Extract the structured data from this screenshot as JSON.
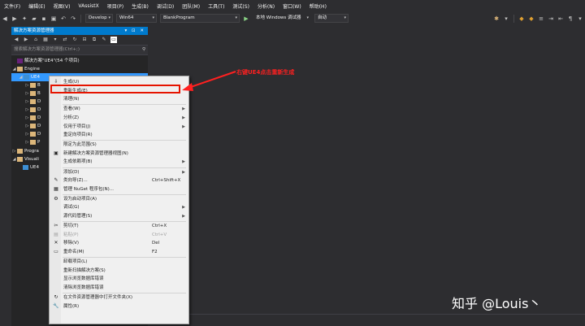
{
  "menubar": [
    "文件(F)",
    "编辑(E)",
    "视图(V)",
    "VAssistX",
    "项目(P)",
    "生成(B)",
    "调试(D)",
    "团队(M)",
    "工具(T)",
    "测试(S)",
    "分析(N)",
    "窗口(W)",
    "帮助(H)"
  ],
  "toolbar": {
    "config": "Develop",
    "platform": "Win64",
    "startup": "BlankProgram",
    "debugger": "本地 Windows 调试器",
    "debug_mode": "自动"
  },
  "solution_explorer": {
    "title": "解决方案资源管理器",
    "title_controls": "▾ ⊡ ✕",
    "search_placeholder": "搜索解决方案资源管理器(Ctrl+;)",
    "solution_label": "解决方案\"UE4\"(54 个项目)",
    "engine_label": "Engine",
    "ue4_label": "UE4",
    "folder_letters": [
      "B",
      "B",
      "D",
      "D",
      "D",
      "D",
      "D",
      "P"
    ],
    "programs_label": "Progra",
    "visualizers_label": "Visuali",
    "ue4_file_label": "UE4"
  },
  "context_menu": {
    "items": [
      {
        "label": "生成(U)",
        "shortcut": "",
        "glyph": "⇩",
        "sub": false,
        "disabled": false
      },
      {
        "label": "重新生成(E)",
        "shortcut": "",
        "glyph": "",
        "sub": false,
        "disabled": false
      },
      {
        "label": "清理(N)",
        "shortcut": "",
        "glyph": "",
        "sub": false,
        "disabled": false
      },
      {
        "label": "查看(W)",
        "shortcut": "",
        "glyph": "",
        "sub": true,
        "disabled": false
      },
      {
        "label": "分析(Z)",
        "shortcut": "",
        "glyph": "",
        "sub": true,
        "disabled": false
      },
      {
        "label": "仅用于项目(J)",
        "shortcut": "",
        "glyph": "",
        "sub": true,
        "disabled": false
      },
      {
        "label": "重定向项目(R)",
        "shortcut": "",
        "glyph": "",
        "sub": false,
        "disabled": false
      },
      {
        "label": "限定为此范围(S)",
        "shortcut": "",
        "glyph": "",
        "sub": false,
        "disabled": false
      },
      {
        "label": "新建解决方案资源管理器视图(N)",
        "shortcut": "",
        "glyph": "▣",
        "sub": false,
        "disabled": false
      },
      {
        "label": "生成依赖项(B)",
        "shortcut": "",
        "glyph": "",
        "sub": true,
        "disabled": false
      },
      {
        "label": "添加(D)",
        "shortcut": "",
        "glyph": "",
        "sub": true,
        "disabled": false
      },
      {
        "label": "类向导(Z)...",
        "shortcut": "Ctrl+Shift+X",
        "glyph": "✎",
        "sub": false,
        "disabled": false
      },
      {
        "label": "管理 NuGet 程序包(N)...",
        "shortcut": "",
        "glyph": "▦",
        "sub": false,
        "disabled": false
      },
      {
        "label": "设为启动项目(A)",
        "shortcut": "",
        "glyph": "⚙",
        "sub": false,
        "disabled": false
      },
      {
        "label": "调试(G)",
        "shortcut": "",
        "glyph": "",
        "sub": true,
        "disabled": false
      },
      {
        "label": "源代码管理(S)",
        "shortcut": "",
        "glyph": "",
        "sub": true,
        "disabled": false
      },
      {
        "label": "剪切(T)",
        "shortcut": "Ctrl+X",
        "glyph": "✂",
        "sub": false,
        "disabled": false
      },
      {
        "label": "粘贴(P)",
        "shortcut": "Ctrl+V",
        "glyph": "▤",
        "sub": false,
        "disabled": true
      },
      {
        "label": "移除(V)",
        "shortcut": "Del",
        "glyph": "✕",
        "sub": false,
        "disabled": false
      },
      {
        "label": "重命名(M)",
        "shortcut": "F2",
        "glyph": "▭",
        "sub": false,
        "disabled": false
      },
      {
        "label": "卸载项目(L)",
        "shortcut": "",
        "glyph": "",
        "sub": false,
        "disabled": false
      },
      {
        "label": "重新扫描解决方案(S)",
        "shortcut": "",
        "glyph": "",
        "sub": false,
        "disabled": false
      },
      {
        "label": "显示浏览数据库错误",
        "shortcut": "",
        "glyph": "",
        "sub": false,
        "disabled": false
      },
      {
        "label": "清除浏览数据库错误",
        "shortcut": "",
        "glyph": "",
        "sub": false,
        "disabled": false
      },
      {
        "label": "在文件资源管理器中打开文件夹(X)",
        "shortcut": "",
        "glyph": "↻",
        "sub": false,
        "disabled": false
      },
      {
        "label": "属性(R)",
        "shortcut": "",
        "glyph": "🔧",
        "sub": false,
        "disabled": false
      }
    ]
  },
  "annotation": "右键UE4点击重新生成",
  "watermark": "知乎 @Louis丶",
  "colors": {
    "accent": "#007acc",
    "highlight_box": "#e51400",
    "annotation": "#ff2020"
  }
}
